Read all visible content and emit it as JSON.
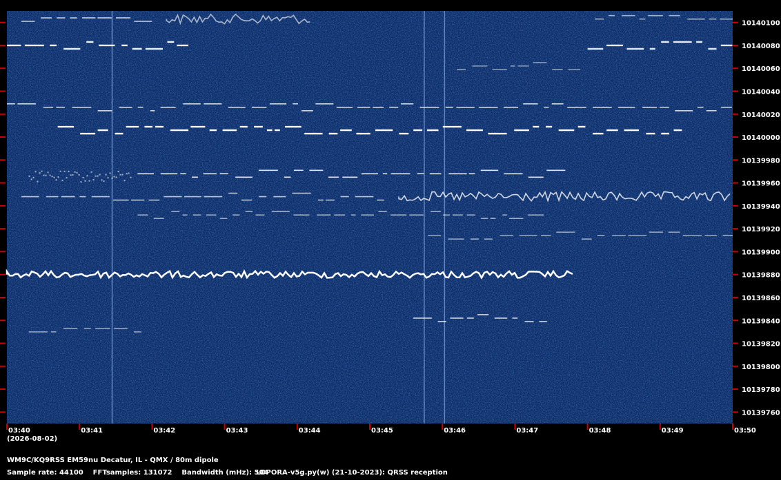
{
  "chart_data": {
    "type": "heatmap",
    "subtype": "spectrogram (waterfall)",
    "date_label": "(2026-08-02)",
    "x_ticks": [
      "03:40",
      "03:41",
      "03:42",
      "03:43",
      "03:44",
      "03:45",
      "03:46",
      "03:47",
      "03:48",
      "03:49",
      "03:50"
    ],
    "y_ticks": [
      10140100,
      10140080,
      10140060,
      10140040,
      10140020,
      10140000,
      10139980,
      10139960,
      10139940,
      10139920,
      10139900,
      10139880,
      10139860,
      10139840,
      10139820,
      10139800,
      10139780,
      10139760
    ],
    "xlim_minutes": [
      0,
      10
    ],
    "ylim_hz": [
      10139750,
      10140110
    ],
    "colors": {
      "background": "#0b2a66",
      "signal": "#ffffff",
      "tick_marks": "#cc0000",
      "frame": "#000000"
    },
    "signals": [
      {
        "f_hz": 10140080,
        "start": 0.0,
        "end": 2.5,
        "style": "dash",
        "strength": 0.9
      },
      {
        "f_hz": 10140080,
        "start": 8.0,
        "end": 10.0,
        "style": "dash",
        "strength": 0.85
      },
      {
        "f_hz": 10140104,
        "start": 0.2,
        "end": 2.0,
        "style": "dash",
        "strength": 0.6
      },
      {
        "f_hz": 10140103,
        "start": 2.2,
        "end": 4.2,
        "style": "wiggle",
        "strength": 0.45
      },
      {
        "f_hz": 10140103,
        "start": 8.1,
        "end": 10.0,
        "style": "dash",
        "strength": 0.4
      },
      {
        "f_hz": 10140062,
        "start": 6.2,
        "end": 7.9,
        "style": "dash",
        "strength": 0.25
      },
      {
        "f_hz": 10140026,
        "start": 0.0,
        "end": 10.0,
        "style": "dash",
        "strength": 0.7
      },
      {
        "f_hz": 10140006,
        "start": 0.7,
        "end": 9.3,
        "style": "dash",
        "strength": 1.0
      },
      {
        "f_hz": 10139966,
        "start": 0.3,
        "end": 1.7,
        "style": "noise",
        "strength": 0.4
      },
      {
        "f_hz": 10139968,
        "start": 1.8,
        "end": 7.7,
        "style": "dash",
        "strength": 0.8
      },
      {
        "f_hz": 10139948,
        "start": 0.2,
        "end": 5.2,
        "style": "dash",
        "strength": 0.55
      },
      {
        "f_hz": 10139948,
        "start": 5.4,
        "end": 10.0,
        "style": "wiggle",
        "strength": 0.7
      },
      {
        "f_hz": 10139932,
        "start": 1.8,
        "end": 7.4,
        "style": "dash",
        "strength": 0.35
      },
      {
        "f_hz": 10139914,
        "start": 5.8,
        "end": 10.0,
        "style": "dash",
        "strength": 0.35
      },
      {
        "f_hz": 10139880,
        "start": 0.0,
        "end": 7.8,
        "style": "wiggle",
        "strength": 1.0
      },
      {
        "f_hz": 10139842,
        "start": 5.6,
        "end": 7.5,
        "style": "dash",
        "strength": 0.7
      },
      {
        "f_hz": 10139833,
        "start": 0.3,
        "end": 1.9,
        "style": "dash",
        "strength": 0.3
      }
    ],
    "vertical_lines_min": [
      1.45,
      5.75,
      6.03
    ]
  },
  "footer": {
    "line1": "WM9C/KQ9RSS EM59nu Decatur, IL - QMX / 80m dipole",
    "line2_left": "Sample rate: 44100    FFTsamples: 131072    Bandwidth (mHz): 504",
    "line2_right": "LOPORA-v5g.py(w) (21-10-2023): QRSS reception"
  }
}
